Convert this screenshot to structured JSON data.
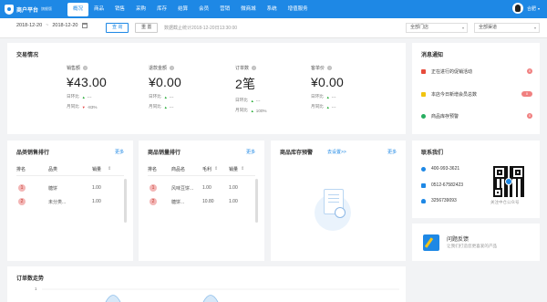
{
  "app": {
    "logo_title": "商户平台",
    "logo_sub": "旗舰版"
  },
  "nav": [
    {
      "label": "概况",
      "active": true
    },
    {
      "label": "商品"
    },
    {
      "label": "销售"
    },
    {
      "label": "采购"
    },
    {
      "label": "库存"
    },
    {
      "label": "结算"
    },
    {
      "label": "会员"
    },
    {
      "label": "营销"
    },
    {
      "label": "微商城"
    },
    {
      "label": "系统"
    },
    {
      "label": "增值服务"
    }
  ],
  "user": {
    "name": "合肥"
  },
  "filter": {
    "start_date": "2018-12-20",
    "date_sep": "~",
    "end_date": "2018-12-20",
    "query_btn": "查 询",
    "reset_btn": "重 置",
    "note": "数据截止统计2018-12-20日13:30:00",
    "store_select": "全部门店",
    "channel_select": "全部渠道"
  },
  "trade": {
    "title": "交易情况",
    "kpis": [
      {
        "label": "销售额",
        "value": "¥43.00",
        "dod_label": "日环比",
        "dod": "---",
        "mom_label": "月同比",
        "mom": "-83%",
        "mom_dir": "down"
      },
      {
        "label": "退款金额",
        "value": "¥0.00",
        "dod_label": "日环比",
        "dod": "---",
        "mom_label": "月同比",
        "mom": "---",
        "mom_dir": "up"
      },
      {
        "label": "订单数",
        "value": "2笔",
        "dod_label": "日环比",
        "dod": "---",
        "mom_label": "月同比",
        "mom": "100%",
        "mom_dir": "up"
      },
      {
        "label": "客单价",
        "value": "¥0.00",
        "dod_label": "日环比",
        "dod": "---",
        "mom_label": "月同比",
        "mom": "---",
        "mom_dir": "up"
      }
    ]
  },
  "category_rank": {
    "title": "品类销售排行",
    "more": "更多",
    "headers": [
      "排名",
      "品类",
      "销量"
    ],
    "rows": [
      {
        "rank": "1",
        "name": "糖饼",
        "qty": "1.00"
      },
      {
        "rank": "2",
        "name": "未分类...",
        "qty": "1.00"
      }
    ]
  },
  "product_rank": {
    "title": "商品销量排行",
    "more": "更多",
    "headers": [
      "排名",
      "商品名",
      "毛利",
      "销量"
    ],
    "rows": [
      {
        "rank": "1",
        "name": "风味豆饼...",
        "profit": "1.00",
        "qty": "1.00"
      },
      {
        "rank": "2",
        "name": "糖饼...",
        "profit": "10.80",
        "qty": "1.00"
      }
    ]
  },
  "stock_alert": {
    "title": "商品库存预警",
    "link": "去设置>>",
    "more": "更多"
  },
  "messages": {
    "title": "消息通知",
    "items": [
      {
        "label": "正在进行的促销活动",
        "count": "0",
        "color": "#e74c3c"
      },
      {
        "label": "本店今日新增会员总数",
        "count": "0",
        "color": "#f1c40f"
      },
      {
        "label": "商品库存预警",
        "count": "0",
        "color": "#27ae60"
      }
    ]
  },
  "contact": {
    "title": "联系我们",
    "phone": "400-993-3621",
    "tel": "0512-67582423",
    "qq": "3256739093",
    "qr_caption": "关注中仓公众号"
  },
  "feedback": {
    "title": "问题反馈",
    "subtitle": "让我们打造您更喜爱的产品"
  },
  "order_trend": {
    "title": "订单数走势",
    "chart_data": {
      "type": "line",
      "y_tick": "1"
    }
  },
  "colors": {
    "primary": "#1e88e5",
    "up": "#2cae3b",
    "down": "#e54545"
  }
}
